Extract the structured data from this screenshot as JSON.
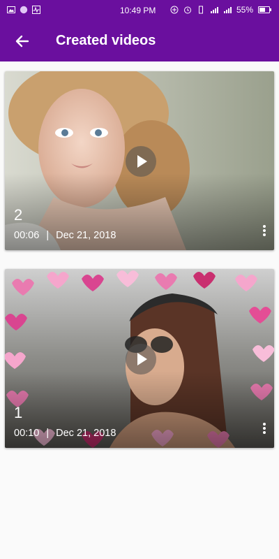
{
  "status_bar": {
    "time": "10:49 PM",
    "battery": "55%"
  },
  "app_bar": {
    "title": "Created videos"
  },
  "videos": [
    {
      "number": "2",
      "duration": "00:06",
      "separator": "|",
      "date": "Dec 21, 2018"
    },
    {
      "number": "1",
      "duration": "00:10",
      "separator": "|",
      "date": "Dec 21, 2018"
    }
  ],
  "colors": {
    "primary": "#6a0f9e",
    "background": "#fafafa"
  }
}
